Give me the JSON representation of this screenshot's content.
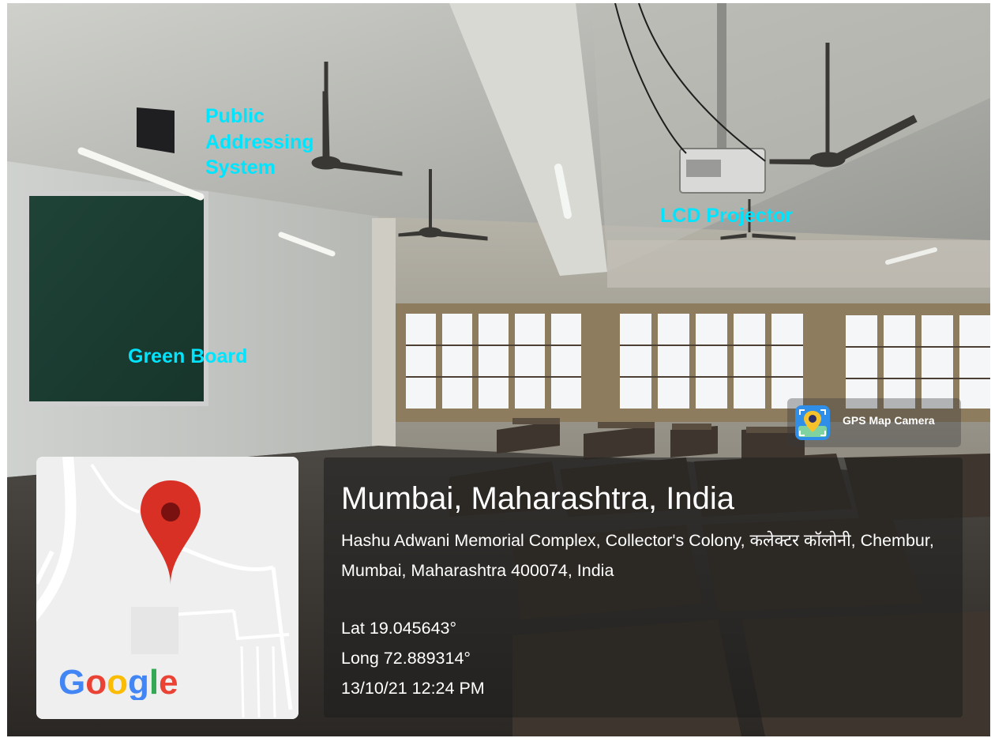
{
  "annotations": {
    "public_addressing_system": "Public Addressing System",
    "green_board": "Green Board",
    "lcd_projector": "LCD Projector"
  },
  "watermark": {
    "app_name": "GPS Map Camera",
    "icon": "gps-map-camera-app-icon"
  },
  "map": {
    "icon": "map-pin-icon",
    "pin_color": "#d93025",
    "logo": "Google"
  },
  "location": {
    "title": "Mumbai, Maharashtra, India",
    "address": "Hashu Adwani Memorial Complex, Collector's Colony, कलेक्टर कॉलोनी, Chembur, Mumbai, Maharashtra 400074, India",
    "latitude": "Lat 19.045643°",
    "longitude": "Long 72.889314°",
    "datetime": "13/10/21 12:24 PM"
  },
  "colors": {
    "annotation_text": "#00e5ff",
    "overlay_text": "#ffffff"
  }
}
